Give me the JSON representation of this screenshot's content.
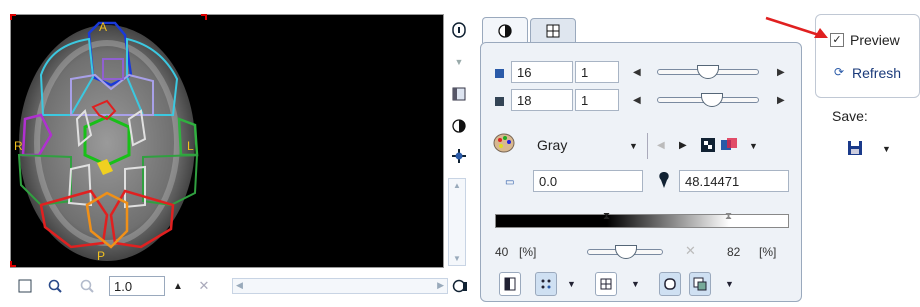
{
  "viewer": {
    "orientation_labels": {
      "anterior": "A",
      "right": "R",
      "left": "L",
      "posterior": "P"
    }
  },
  "bottom_toolbar": {
    "zoom_value": "1.0"
  },
  "tabs": [
    {
      "icon": "contrast-tab-icon",
      "active": true
    },
    {
      "icon": "grid-tab-icon",
      "active": false
    }
  ],
  "slice_controls": {
    "row1": {
      "value": "16",
      "step": "1"
    },
    "row2": {
      "value": "18",
      "step": "1"
    }
  },
  "color_map": {
    "label": "Gray"
  },
  "range": {
    "min": "0.0",
    "max": "48.14471"
  },
  "percent": {
    "low": "40",
    "high": "82",
    "unit": "[%]"
  },
  "right_panel": {
    "preview_label": "Preview",
    "preview_checked": true,
    "refresh_label": "Refresh",
    "save_label": "Save:"
  },
  "colors": {
    "accent": "#2a5aa8",
    "arrow": "#e02020"
  }
}
